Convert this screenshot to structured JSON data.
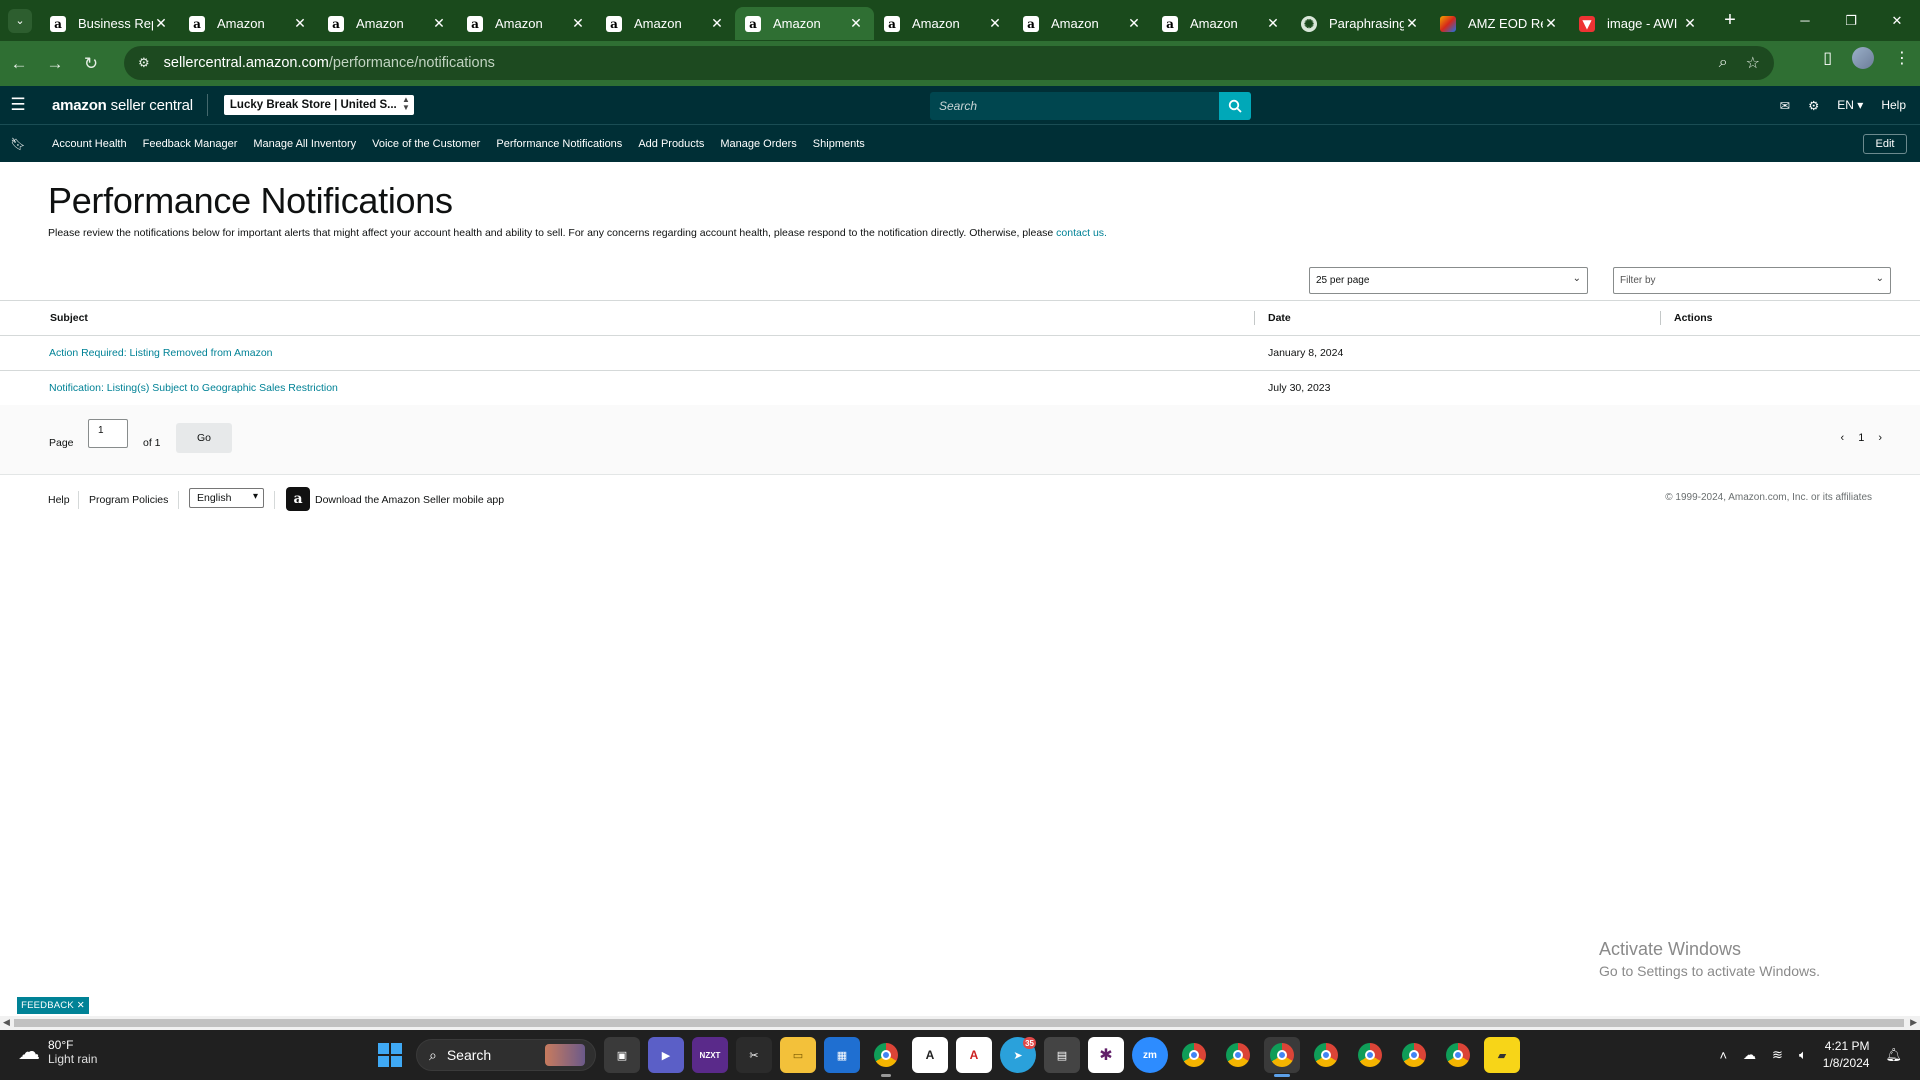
{
  "browser": {
    "tabs": [
      {
        "label": "Business Rep",
        "icon": "amazon-icon"
      },
      {
        "label": "Amazon",
        "icon": "amazon-icon"
      },
      {
        "label": "Amazon",
        "icon": "amazon-icon"
      },
      {
        "label": "Amazon",
        "icon": "amazon-icon"
      },
      {
        "label": "Amazon",
        "icon": "amazon-icon"
      },
      {
        "label": "Amazon",
        "icon": "amazon-icon",
        "active": true
      },
      {
        "label": "Amazon",
        "icon": "amazon-icon"
      },
      {
        "label": "Amazon",
        "icon": "amazon-icon"
      },
      {
        "label": "Amazon",
        "icon": "amazon-icon"
      },
      {
        "label": "Paraphrasing",
        "icon": "chatgpt-icon"
      },
      {
        "label": "AMZ EOD Re",
        "icon": "app-icon"
      },
      {
        "label": "image - AWI",
        "icon": "drive-icon"
      }
    ],
    "url_host": "sellercentral.amazon.com",
    "url_path": "/performance/notifications"
  },
  "header": {
    "logo_bold": "amazon",
    "logo_text": "seller central",
    "store": "Lucky Break Store | United S...",
    "search_placeholder": "Search",
    "lang": "EN",
    "help": "Help"
  },
  "nav": {
    "items": [
      "Account Health",
      "Feedback Manager",
      "Manage All Inventory",
      "Voice of the Customer",
      "Performance Notifications",
      "Add Products",
      "Manage Orders",
      "Shipments"
    ],
    "edit": "Edit"
  },
  "page": {
    "title": "Performance Notifications",
    "intro": "Please review the notifications below for important alerts that might affect your account health and ability to sell. For any concerns regarding account health, please respond to the notification directly. Otherwise, please ",
    "intro_link": "contact us.",
    "per_page": "25 per page",
    "filter_placeholder": "Filter by"
  },
  "table": {
    "headers": {
      "subject": "Subject",
      "date": "Date",
      "actions": "Actions"
    },
    "rows": [
      {
        "subject": "Action Required: Listing Removed from Amazon",
        "date": "January 8, 2024"
      },
      {
        "subject": "Notification: Listing(s) Subject to Geographic Sales Restriction",
        "date": "July 30, 2023"
      }
    ]
  },
  "pager": {
    "page_label": "Page",
    "page_value": "1",
    "of_label": "of 1",
    "go": "Go",
    "current": "1"
  },
  "footer": {
    "help": "Help",
    "policies": "Program Policies",
    "language": "English",
    "app_text": "Download the Amazon Seller mobile app",
    "copyright": "© 1999-2024, Amazon.com, Inc. or its affiliates"
  },
  "watermark": {
    "line1": "Activate Windows",
    "line2": "Go to Settings to activate Windows."
  },
  "feedback": "FEEDBACK",
  "taskbar": {
    "temp": "80°F",
    "weather": "Light rain",
    "search": "Search",
    "telegram_badge": "35",
    "time": "4:21 PM",
    "date": "1/8/2024"
  }
}
